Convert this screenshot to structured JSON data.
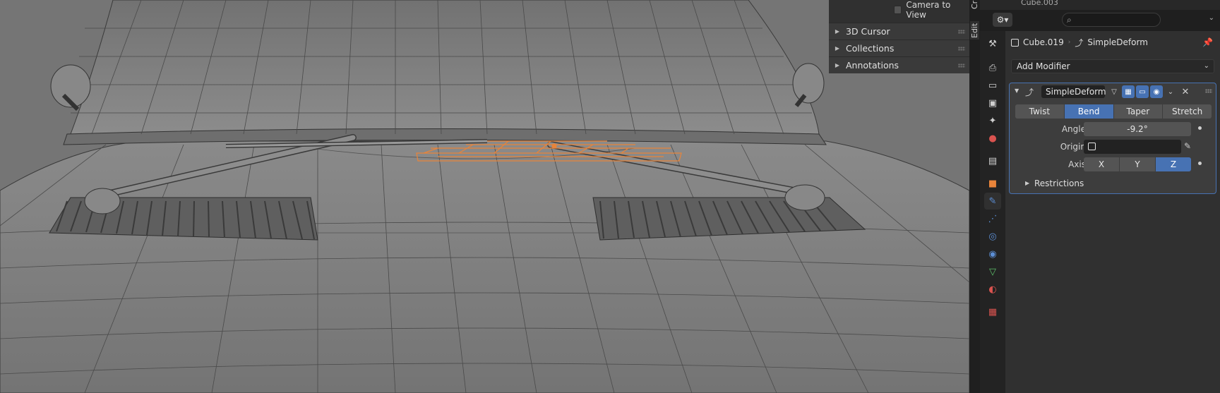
{
  "viewport": {
    "camera_to_view_label": "Camera to View",
    "sections": [
      {
        "label": "3D Cursor"
      },
      {
        "label": "Collections"
      },
      {
        "label": "Annotations"
      }
    ],
    "sidebar_tabs": [
      "Edit",
      "Cr"
    ]
  },
  "outliner": {
    "partial_item": "Cube.003"
  },
  "properties": {
    "search_placeholder": "",
    "tabs": [
      {
        "name": "tool",
        "icon": "tool-icon",
        "glyph": "⚒",
        "color": "#cfcfcf"
      },
      {
        "name": "render",
        "icon": "render-icon",
        "glyph": "📷",
        "color": "#cfcfcf"
      },
      {
        "name": "output",
        "icon": "output-icon",
        "glyph": "🖶",
        "color": "#cfcfcf"
      },
      {
        "name": "view-layer",
        "icon": "view-layer-icon",
        "glyph": "▣",
        "color": "#cfcfcf"
      },
      {
        "name": "scene",
        "icon": "scene-icon",
        "glyph": "✦",
        "color": "#cfcfcf"
      },
      {
        "name": "world",
        "icon": "world-icon",
        "glyph": "●",
        "color": "#d9534f"
      },
      {
        "name": "collection",
        "icon": "collection-icon",
        "glyph": "▤",
        "color": "#cfcfcf"
      },
      {
        "name": "object",
        "icon": "object-icon",
        "glyph": "■",
        "color": "#e8843a"
      },
      {
        "name": "modifiers",
        "icon": "wrench-icon",
        "glyph": "🔧",
        "color": "#5c8fd6",
        "active": true
      },
      {
        "name": "particles",
        "icon": "particles-icon",
        "glyph": "⋰",
        "color": "#5c8fd6"
      },
      {
        "name": "physics",
        "icon": "physics-icon",
        "glyph": "◎",
        "color": "#5c8fd6"
      },
      {
        "name": "constraints",
        "icon": "constraints-icon",
        "glyph": "⛓",
        "color": "#5c8fd6"
      },
      {
        "name": "data",
        "icon": "mesh-data-icon",
        "glyph": "▽",
        "color": "#5cc06a"
      },
      {
        "name": "material",
        "icon": "material-icon",
        "glyph": "◐",
        "color": "#d9534f"
      },
      {
        "name": "texture",
        "icon": "texture-icon",
        "glyph": "▦",
        "color": "#d9534f"
      }
    ],
    "breadcrumb": {
      "object": "Cube.019",
      "modifier": "SimpleDeform"
    },
    "add_modifier_label": "Add Modifier",
    "modifier": {
      "name": "SimpleDeform",
      "modes": [
        {
          "label": "Twist",
          "active": false
        },
        {
          "label": "Bend",
          "active": true
        },
        {
          "label": "Taper",
          "active": false
        },
        {
          "label": "Stretch",
          "active": false
        }
      ],
      "angle_label": "Angle",
      "angle_value": "-9.2°",
      "origin_label": "Origin",
      "axis_label": "Axis",
      "axes": [
        {
          "label": "X",
          "active": false
        },
        {
          "label": "Y",
          "active": false
        },
        {
          "label": "Z",
          "active": true
        }
      ],
      "restrictions_label": "Restrictions"
    },
    "colors": {
      "accent": "#4772b3",
      "selection_orange": "#e8843a"
    }
  }
}
